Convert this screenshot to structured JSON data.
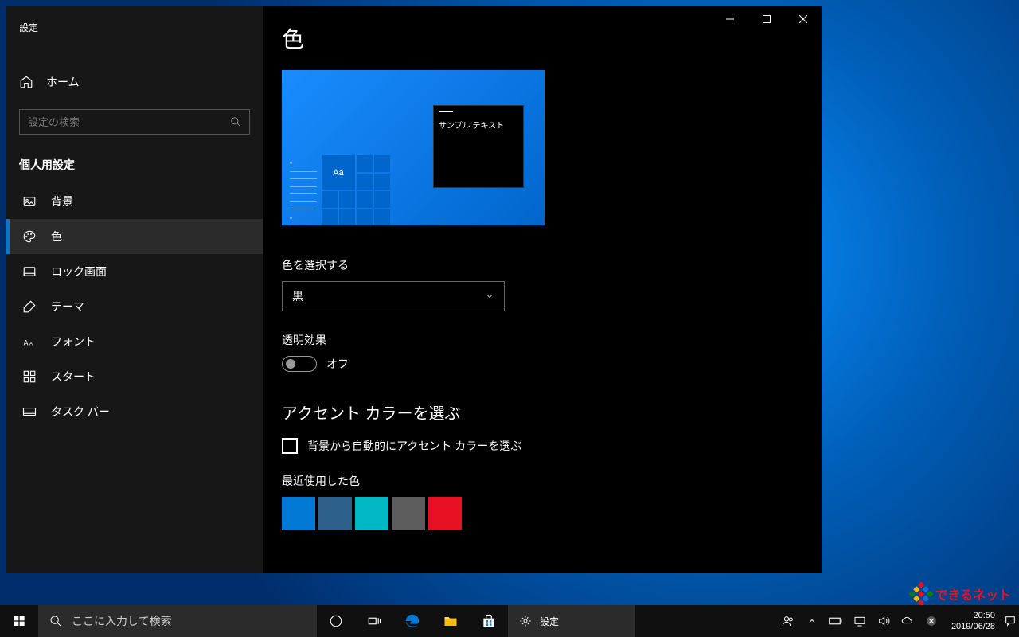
{
  "window": {
    "title": "設定"
  },
  "sidebar": {
    "home": "ホーム",
    "search_placeholder": "設定の検索",
    "section": "個人用設定",
    "items": [
      {
        "label": "背景"
      },
      {
        "label": "色"
      },
      {
        "label": "ロック画面"
      },
      {
        "label": "テーマ"
      },
      {
        "label": "フォント"
      },
      {
        "label": "スタート"
      },
      {
        "label": "タスク バー"
      }
    ]
  },
  "content": {
    "title": "色",
    "preview_sample": "サンプル テキスト",
    "preview_aa": "Aa",
    "choose_color_label": "色を選択する",
    "choose_color_value": "黒",
    "transparency_label": "透明効果",
    "transparency_value": "オフ",
    "accent_heading": "アクセント カラーを選ぶ",
    "auto_accent_label": "背景から自動的にアクセント カラーを選ぶ",
    "recent_colors_label": "最近使用した色",
    "recent_colors": [
      "#0078d4",
      "#2d5f8b",
      "#00b7c3",
      "#5d5d5d",
      "#e81123"
    ]
  },
  "taskbar": {
    "search_placeholder": "ここに入力して検索",
    "active_app": "設定",
    "time": "20:50",
    "date": "2019/06/28"
  },
  "watermark": {
    "text": "できるネット"
  }
}
